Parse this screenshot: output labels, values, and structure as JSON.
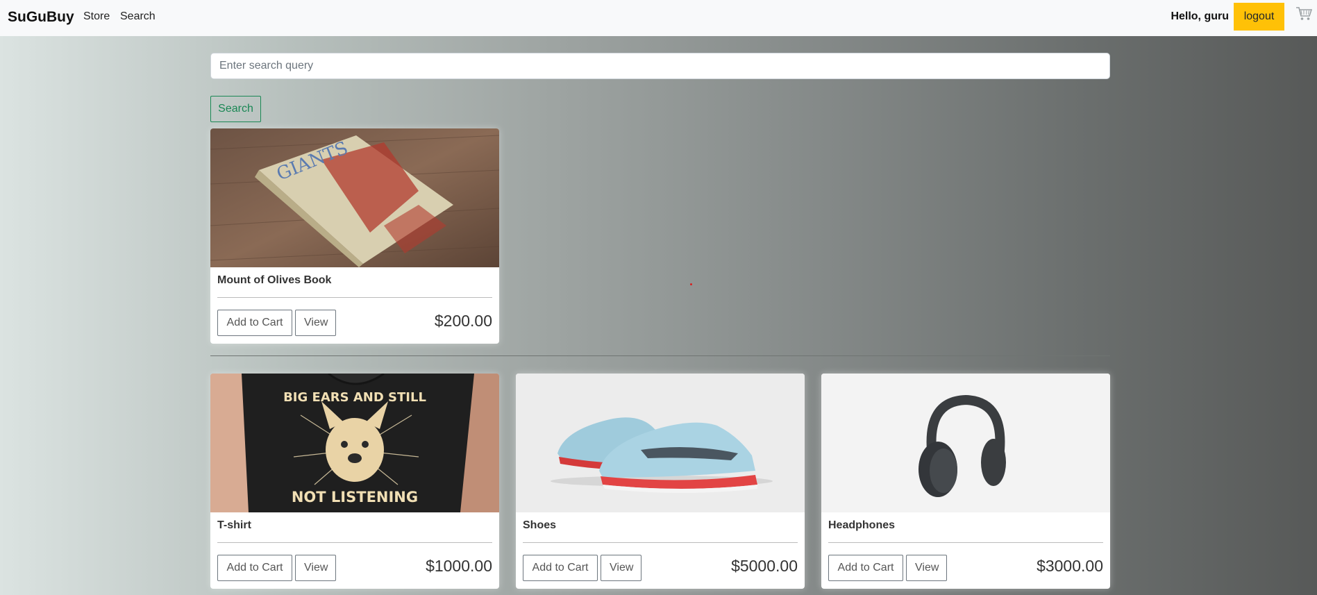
{
  "navbar": {
    "brand": "SuGuBuy",
    "links": [
      "Store",
      "Search"
    ],
    "greeting": "Hello, guru",
    "logout_label": "logout",
    "cart_icon": "cart-icon"
  },
  "search": {
    "placeholder": "Enter search query",
    "value": "",
    "button_label": "Search"
  },
  "results": [
    {
      "title": "Mount of Olives Book",
      "price": "$200.00",
      "add_label": "Add to Cart",
      "view_label": "View"
    }
  ],
  "products": [
    {
      "title": "T-shirt",
      "price": "$1000.00",
      "add_label": "Add to Cart",
      "view_label": "View"
    },
    {
      "title": "Shoes",
      "price": "$5000.00",
      "add_label": "Add to Cart",
      "view_label": "View"
    },
    {
      "title": "Headphones",
      "price": "$3000.00",
      "add_label": "Add to Cart",
      "view_label": "View"
    }
  ],
  "colors": {
    "navbar_bg": "#f8f9fa",
    "logout_bg": "#ffc107",
    "search_btn": "#198754"
  }
}
